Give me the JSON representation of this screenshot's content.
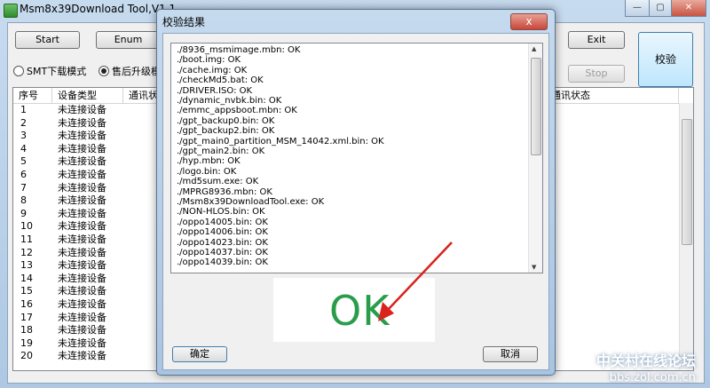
{
  "main": {
    "title": "Msm8x39Download Tool,V1.1",
    "buttons": {
      "start": "Start",
      "enum": "Enum",
      "exit": "Exit",
      "stop": "Stop",
      "verify": "校验"
    },
    "radios": {
      "smt": "SMT下载模式",
      "after_sale": "售后升级模"
    },
    "columns": {
      "index": "序号",
      "device": "设备类型",
      "comm": "通讯状态",
      "comm2": "通讯状态"
    },
    "rows": [
      {
        "n": "1",
        "d": "未连接设备"
      },
      {
        "n": "2",
        "d": "未连接设备"
      },
      {
        "n": "3",
        "d": "未连接设备"
      },
      {
        "n": "4",
        "d": "未连接设备"
      },
      {
        "n": "5",
        "d": "未连接设备"
      },
      {
        "n": "6",
        "d": "未连接设备"
      },
      {
        "n": "7",
        "d": "未连接设备"
      },
      {
        "n": "8",
        "d": "未连接设备"
      },
      {
        "n": "9",
        "d": "未连接设备"
      },
      {
        "n": "10",
        "d": "未连接设备"
      },
      {
        "n": "11",
        "d": "未连接设备"
      },
      {
        "n": "12",
        "d": "未连接设备"
      },
      {
        "n": "13",
        "d": "未连接设备"
      },
      {
        "n": "14",
        "d": "未连接设备"
      },
      {
        "n": "15",
        "d": "未连接设备"
      },
      {
        "n": "16",
        "d": "未连接设备"
      },
      {
        "n": "17",
        "d": "未连接设备"
      },
      {
        "n": "18",
        "d": "未连接设备"
      },
      {
        "n": "19",
        "d": "未连接设备"
      },
      {
        "n": "20",
        "d": "未连接设备"
      }
    ]
  },
  "dialog": {
    "title": "校验结果",
    "close": "x",
    "result": "OK",
    "ok_button": "确定",
    "cancel_button": "取消",
    "lines": [
      "./8936_msmimage.mbn: OK",
      "./boot.img: OK",
      "./cache.img: OK",
      "./checkMd5.bat: OK",
      "./DRIVER.ISO: OK",
      "./dynamic_nvbk.bin: OK",
      "./emmc_appsboot.mbn: OK",
      "./gpt_backup0.bin: OK",
      "./gpt_backup2.bin: OK",
      "./gpt_main0_partition_MSM_14042.xml.bin: OK",
      "./gpt_main2.bin: OK",
      "./hyp.mbn: OK",
      "./logo.bin: OK",
      "./md5sum.exe: OK",
      "./MPRG8936.mbn: OK",
      "./Msm8x39DownloadTool.exe: OK",
      "./NON-HLOS.bin: OK",
      "./oppo14005.bin: OK",
      "./oppo14006.bin: OK",
      "./oppo14023.bin: OK",
      "./oppo14037.bin: OK",
      "./oppo14039.bin: OK"
    ]
  },
  "watermark": {
    "line1": "中关村在线论坛",
    "line2": "bbs.zol.com.cn"
  },
  "colors": {
    "ok_green": "#2a9d4a",
    "arrow_red": "#d9231c"
  }
}
